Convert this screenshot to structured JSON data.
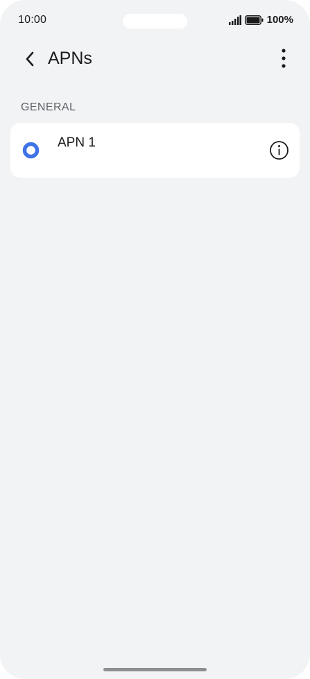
{
  "status_bar": {
    "time": "10:00",
    "battery_percent": "100%",
    "signal_icon": "signal-bars-icon",
    "battery_icon": "battery-icon"
  },
  "header": {
    "title": "APNs",
    "back_icon": "chevron-left-icon",
    "more_icon": "more-vertical-icon"
  },
  "sections": [
    {
      "label": "GENERAL",
      "items": [
        {
          "name": "APN 1",
          "selected": true,
          "info_icon": "info-icon"
        }
      ]
    }
  ],
  "colors": {
    "accent": "#3f73e6",
    "background": "#f2f3f5",
    "card": "#ffffff",
    "text_primary": "#1b1b1b",
    "text_secondary": "#5f6368"
  }
}
